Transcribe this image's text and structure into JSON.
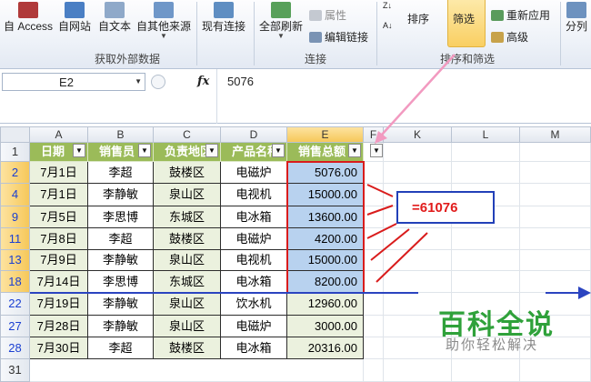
{
  "ribbon": {
    "external": {
      "access": "自 Access",
      "web": "自网站",
      "text": "自文本",
      "other": "自其他来源",
      "group_label": "获取外部数据"
    },
    "existing": "现有连接",
    "connections": {
      "refresh_all": "全部刷新",
      "properties": "属性",
      "edit_links": "编辑链接",
      "group_label": "连接"
    },
    "sort_filter": {
      "sort": "排序",
      "filter": "筛选",
      "reapply": "重新应用",
      "advanced": "高级",
      "group_label": "排序和筛选"
    },
    "split": "分列"
  },
  "formula_bar": {
    "name_box": "E2",
    "fx": "fx",
    "value": "5076"
  },
  "columns": [
    "A",
    "B",
    "C",
    "D",
    "E",
    "F",
    "K",
    "L",
    "M"
  ],
  "row_numbers": [
    "1",
    "2",
    "4",
    "9",
    "11",
    "13",
    "18",
    "22",
    "27",
    "28",
    "31"
  ],
  "table": {
    "headers": [
      "日期",
      "销售员",
      "负责地区",
      "产品名称",
      "销售总额"
    ],
    "rows": [
      [
        "7月1日",
        "李超",
        "鼓楼区",
        "电磁炉",
        "5076.00"
      ],
      [
        "7月1日",
        "李静敏",
        "泉山区",
        "电视机",
        "15000.00"
      ],
      [
        "7月5日",
        "李思博",
        "东城区",
        "电冰箱",
        "13600.00"
      ],
      [
        "7月8日",
        "李超",
        "鼓楼区",
        "电磁炉",
        "4200.00"
      ],
      [
        "7月9日",
        "李静敏",
        "泉山区",
        "电视机",
        "15000.00"
      ],
      [
        "7月14日",
        "李思博",
        "东城区",
        "电冰箱",
        "8200.00"
      ],
      [
        "7月19日",
        "李静敏",
        "泉山区",
        "饮水机",
        "12960.00"
      ],
      [
        "7月28日",
        "李静敏",
        "泉山区",
        "电磁炉",
        "3000.00"
      ],
      [
        "7月30日",
        "李超",
        "鼓楼区",
        "电冰箱",
        "20316.00"
      ]
    ]
  },
  "annotation": {
    "sum": "=61076"
  },
  "watermark": {
    "title": "百科全说",
    "subtitle": "助你轻松解决"
  },
  "colors": {
    "header_green": "#9bbb59",
    "row_tint": "#ebf1de",
    "selection_blue": "#b8d2ef",
    "annotation_red": "#d91c1c",
    "annotation_blue": "#2240b8",
    "arrow_pink": "#f29ac0",
    "watermark_green": "#2fa13a"
  }
}
